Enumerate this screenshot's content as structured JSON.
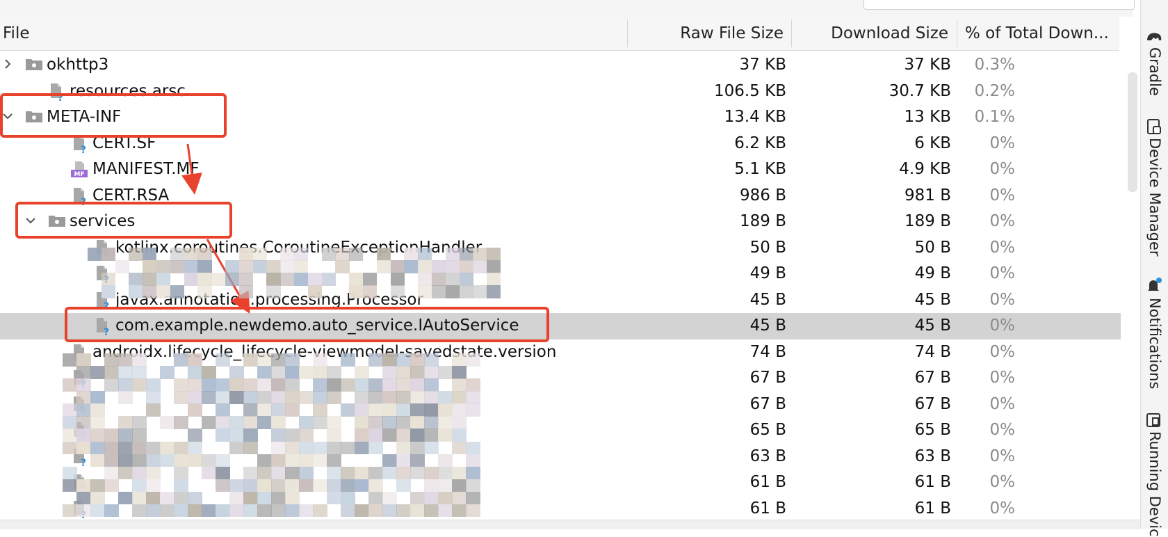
{
  "table": {
    "columns": [
      "File",
      "Raw File Size",
      "Download Size",
      "% of Total Down..."
    ],
    "rows": [
      {
        "name": "okhttp3",
        "kind": "folder",
        "indent": 0,
        "arrow": "collapsed",
        "raw": "37 KB",
        "download": "37 KB",
        "pct": "0.3%"
      },
      {
        "name": "resources.arsc",
        "kind": "file",
        "indent": 1,
        "arrow": "",
        "raw": "106.5 KB",
        "download": "30.7 KB",
        "pct": "0.2%"
      },
      {
        "name": "META-INF",
        "kind": "folder",
        "indent": 0,
        "arrow": "expanded",
        "raw": "13.4 KB",
        "download": "13 KB",
        "pct": "0.1%"
      },
      {
        "name": "CERT.SF",
        "kind": "file",
        "indent": 2,
        "arrow": "",
        "raw": "6.2 KB",
        "download": "6 KB",
        "pct": "0%"
      },
      {
        "name": "MANIFEST.MF",
        "kind": "manifest",
        "indent": 2,
        "arrow": "",
        "raw": "5.1 KB",
        "download": "4.9 KB",
        "pct": "0%"
      },
      {
        "name": "CERT.RSA",
        "kind": "file",
        "indent": 2,
        "arrow": "",
        "raw": "986 B",
        "download": "981 B",
        "pct": "0%"
      },
      {
        "name": "services",
        "kind": "folder",
        "indent": 1,
        "arrow": "expanded",
        "raw": "189 B",
        "download": "189 B",
        "pct": "0%"
      },
      {
        "name": "kotlinx.coroutines.CoroutineExceptionHandler",
        "kind": "file",
        "indent": 3,
        "arrow": "",
        "raw": "50 B",
        "download": "50 B",
        "pct": "0%"
      },
      {
        "name": "",
        "kind": "file",
        "indent": 3,
        "arrow": "",
        "raw": "49 B",
        "download": "49 B",
        "pct": "0%"
      },
      {
        "name": "javax.annotation.processing.Processor",
        "kind": "file",
        "indent": 3,
        "arrow": "",
        "raw": "45 B",
        "download": "45 B",
        "pct": "0%"
      },
      {
        "name": "com.example.newdemo.auto_service.IAutoService",
        "kind": "file",
        "indent": 3,
        "arrow": "",
        "raw": "45 B",
        "download": "45 B",
        "pct": "0%",
        "selected": true
      },
      {
        "name": "androidx.lifecycle_lifecycle-viewmodel-savedstate.version",
        "kind": "file",
        "indent": 2,
        "arrow": "",
        "raw": "74 B",
        "download": "74 B",
        "pct": "0%"
      },
      {
        "name": "",
        "kind": "file",
        "indent": 2,
        "arrow": "",
        "raw": "67 B",
        "download": "67 B",
        "pct": "0%"
      },
      {
        "name": "",
        "kind": "file",
        "indent": 2,
        "arrow": "",
        "raw": "67 B",
        "download": "67 B",
        "pct": "0%"
      },
      {
        "name": "",
        "kind": "file",
        "indent": 2,
        "arrow": "",
        "raw": "65 B",
        "download": "65 B",
        "pct": "0%"
      },
      {
        "name": "",
        "kind": "file",
        "indent": 2,
        "arrow": "",
        "raw": "63 B",
        "download": "63 B",
        "pct": "0%"
      },
      {
        "name": "",
        "kind": "file",
        "indent": 2,
        "arrow": "",
        "raw": "61 B",
        "download": "61 B",
        "pct": "0%"
      },
      {
        "name": "",
        "kind": "file",
        "indent": 2,
        "arrow": "",
        "raw": "61 B",
        "download": "61 B",
        "pct": "0%"
      }
    ]
  },
  "manifest_badge": "MF",
  "toolwindows": [
    {
      "label": "Gradle",
      "icon": "gradle-elephant-icon"
    },
    {
      "label": "Device Manager",
      "icon": "device-manager-icon"
    },
    {
      "label": "Notifications",
      "icon": "bell-icon"
    },
    {
      "label": "Running Devic",
      "icon": "running-devices-icon"
    }
  ],
  "colors": {
    "highlight": "#e8412c",
    "selected_row": "#d3d3d3",
    "file_icon_question": "#2f8fd8",
    "manifest_badge": "#9b6bd6"
  }
}
